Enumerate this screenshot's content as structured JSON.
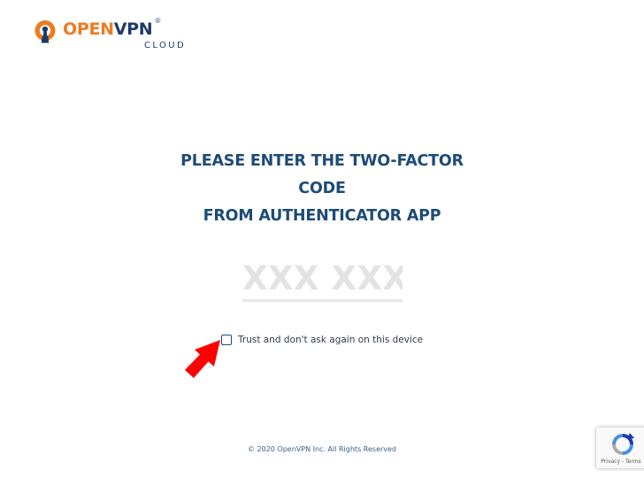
{
  "brand": {
    "open": "OPEN",
    "vpn": "VPN",
    "registered": "®",
    "sub": "CLOUD",
    "accent_color": "#ee7b21",
    "primary_color": "#1b3a6b"
  },
  "heading": {
    "line1": "PLEASE ENTER THE TWO-FACTOR",
    "line2": "CODE",
    "line3": "FROM AUTHENTICATOR APP"
  },
  "code_input": {
    "placeholder": "XXX XXX",
    "value": ""
  },
  "trust": {
    "label": "Trust and don't ask again on this device",
    "checked": false
  },
  "annotation": {
    "icon": "red-arrow-icon",
    "color": "#ff0000"
  },
  "footer": {
    "copyright": "© 2020 OpenVPN Inc. All Rights Reserved"
  },
  "recaptcha": {
    "icon": "recaptcha-icon",
    "privacy": "Privacy",
    "separator": " - ",
    "terms": "Terms"
  }
}
